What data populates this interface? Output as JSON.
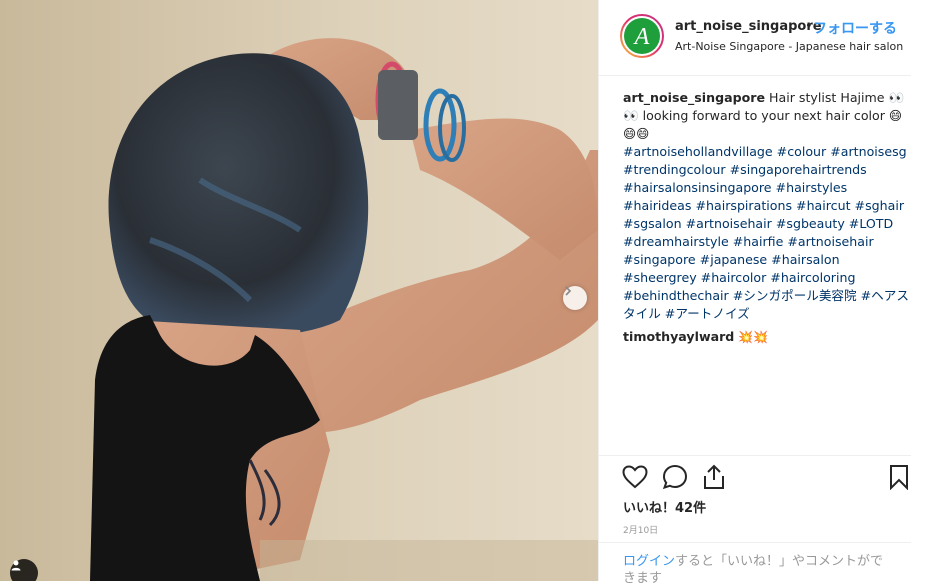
{
  "post": {
    "username": "art_noise_singapore",
    "separator": "•",
    "follow_label": "フォローする",
    "location": "Art-Noise Singapore - Japanese hair salon",
    "avatar_letter": "A"
  },
  "caption": {
    "username": "art_noise_singapore",
    "text": "Hair stylist Hajime 👀👀 looking forward to your next hair color 😄😄😄",
    "hashtags": "#artnoisehollandvillage #colour #artnoisesg #trendingcolour #singaporehairtrends #hairsalonsinsingapore #hairstyles #hairideas #hairspirations #haircut #sghair #sgsalon #artnoisehair #sgbeauty #LOTD #dreamhairstyle #hairfie #artnoisehair #singapore #japanese #hairsalon #sheergrey #haircolor #haircoloring #behindthechair #シンガポール美容院 #ヘアスタイル #アートノイズ"
  },
  "comment": {
    "username": "timothyaylward",
    "text": "💥💥"
  },
  "actions": {
    "like_icon": "heart-icon",
    "comment_icon": "comment-icon",
    "share_icon": "share-icon",
    "save_icon": "bookmark-icon"
  },
  "likes_label": "いいね！42件",
  "date_label": "2月10日",
  "login_prompt": {
    "link": "ログイン",
    "rest": "すると「いいね！」やコメントができます"
  },
  "colors": {
    "accent": "#3897f0",
    "hashtag": "#003569",
    "logo_green": "#1f9e3c"
  }
}
